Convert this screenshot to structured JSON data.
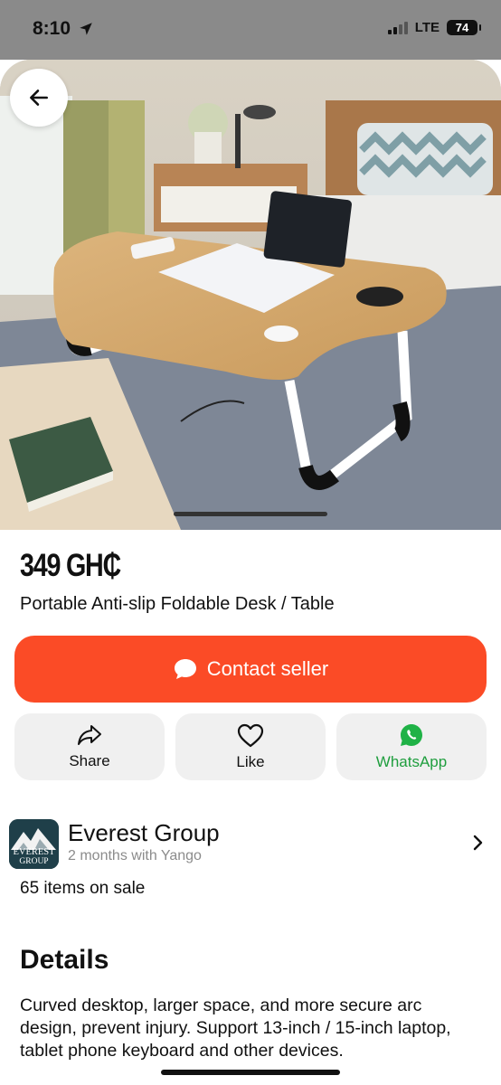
{
  "status_bar": {
    "time": "8:10",
    "network": "LTE",
    "battery": "74"
  },
  "product": {
    "price": "349 GH₵",
    "title": "Portable Anti-slip Foldable Desk / Table",
    "image_icon": "product-photo"
  },
  "buttons": {
    "contact_label": "Contact seller",
    "share_label": "Share",
    "like_label": "Like",
    "whatsapp_label": "WhatsApp"
  },
  "seller": {
    "name": "Everest Group",
    "subtitle": "2 months with Yango",
    "logo_text_top": "EVEREST",
    "logo_text_bottom": "GROUP",
    "items_on_sale": "65 items on sale"
  },
  "details": {
    "heading": "Details",
    "text": "Curved desktop, larger space, and more secure arc design, prevent injury. Support 13-inch / 15-inch laptop, tablet phone keyboard and other devices."
  },
  "colors": {
    "accent": "#fb4b26",
    "whatsapp": "#1f9e3e",
    "button_bg": "#f0f0f0"
  }
}
